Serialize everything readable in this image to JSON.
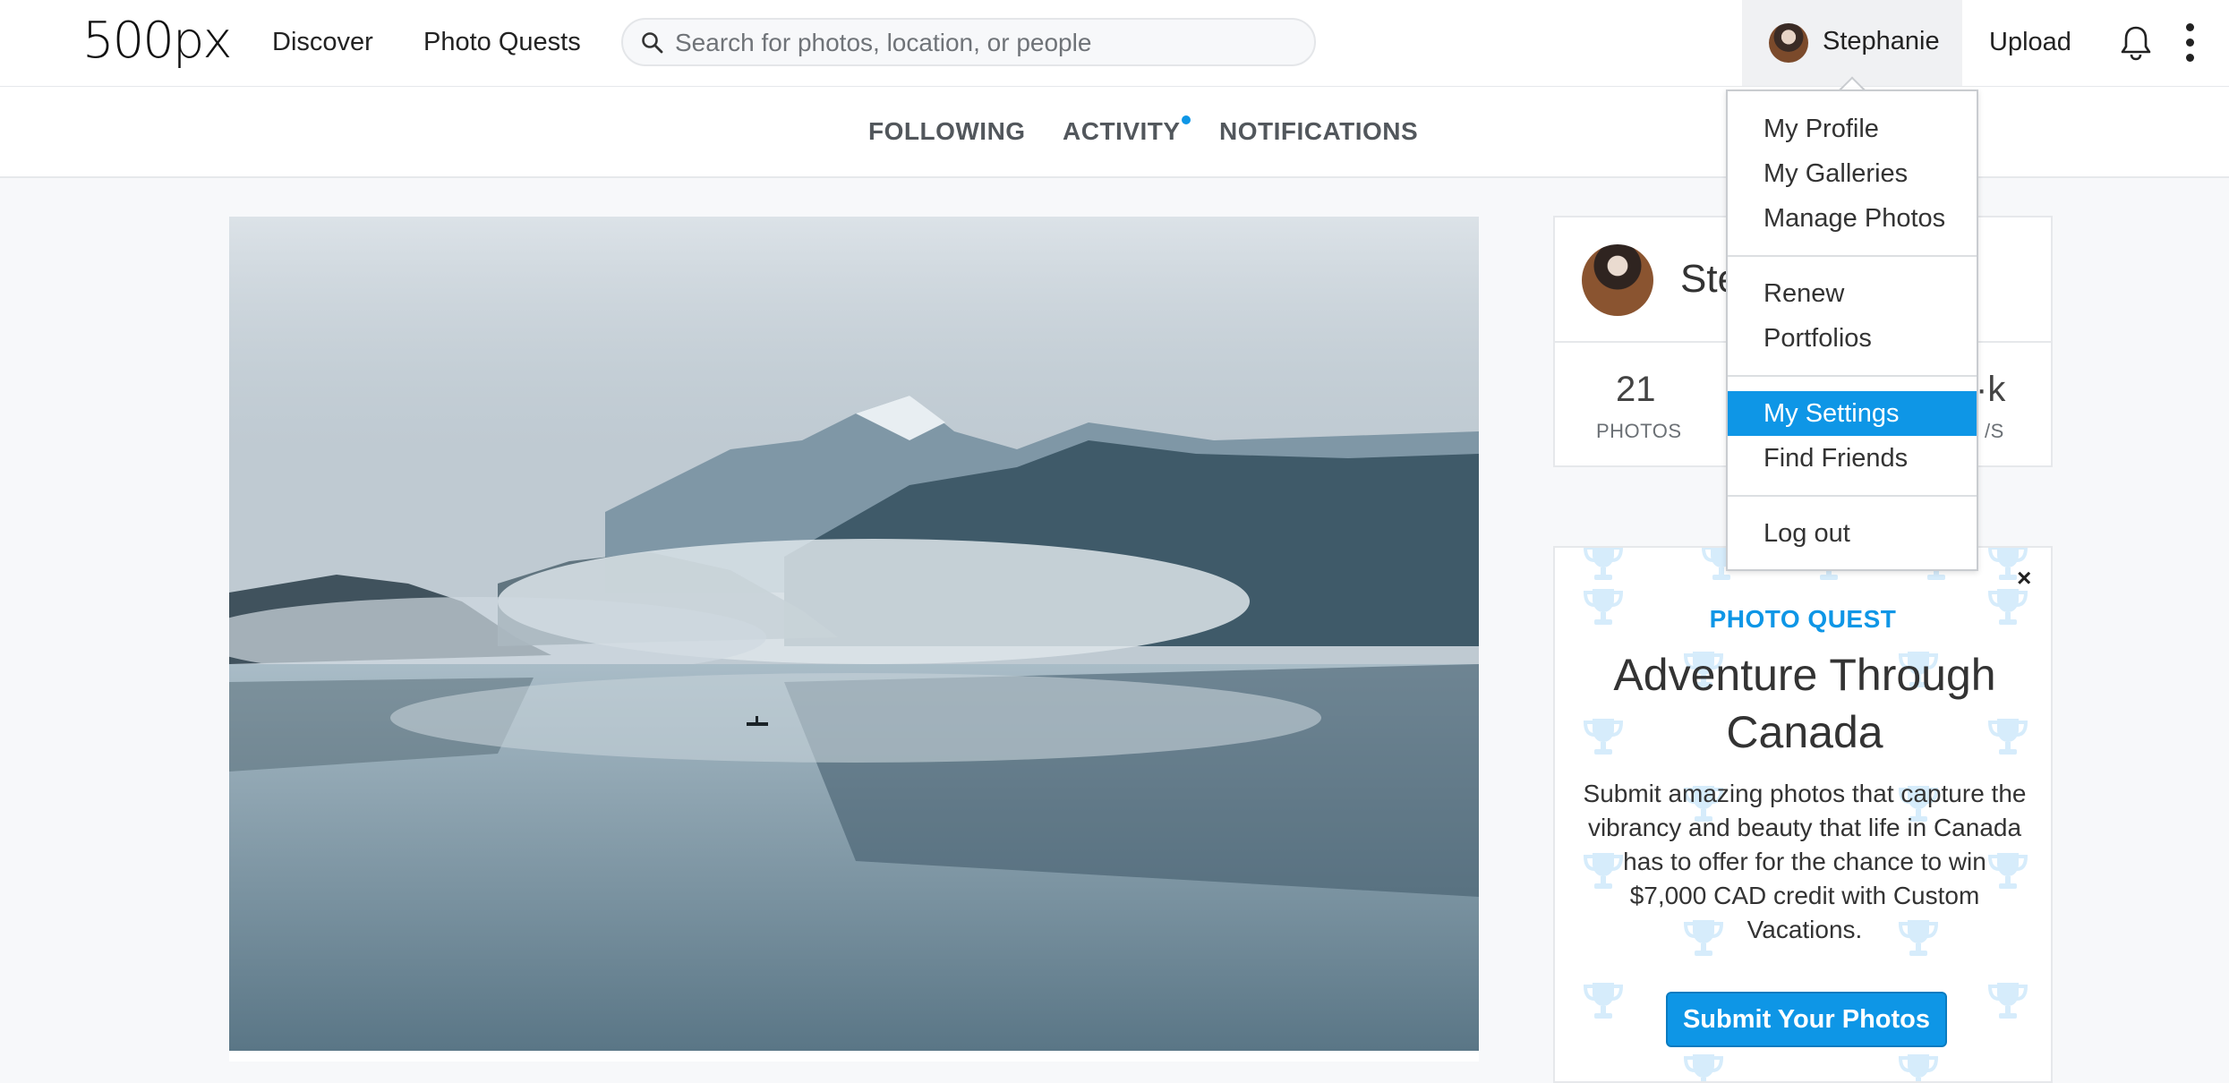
{
  "nav": {
    "logo": "500px",
    "links": [
      "Discover",
      "Photo Quests"
    ],
    "search_placeholder": "Search for photos, location, or people",
    "user_name": "Stephanie",
    "upload_label": "Upload"
  },
  "subnav": {
    "tabs": [
      "FOLLOWING",
      "ACTIVITY",
      "NOTIFICATIONS"
    ]
  },
  "profile_card": {
    "name": "Ste",
    "stats": [
      {
        "value": "21",
        "label": "PHOTOS"
      },
      {
        "value": "·k",
        "label": "/S"
      }
    ]
  },
  "dropdown": {
    "items": [
      "My Profile",
      "My Galleries",
      "Manage Photos",
      "Renew",
      "Portfolios",
      "My Settings",
      "Find Friends",
      "Log out"
    ],
    "active_item": "My Settings"
  },
  "quest": {
    "label": "PHOTO QUEST",
    "title": "Adventure Through Canada",
    "description": "Submit amazing photos that capture the vibrancy and beauty that life in Canada has to offer for the chance to win $7,000 CAD credit with Custom Vacations.",
    "button_label": "Submit Your Photos",
    "close_label": "×"
  },
  "colors": {
    "accent": "#0e96e6",
    "background": "#f7f8fa"
  },
  "icons": [
    "search-icon",
    "bell-icon",
    "more-vertical-icon",
    "close-icon",
    "trophy-icon"
  ]
}
